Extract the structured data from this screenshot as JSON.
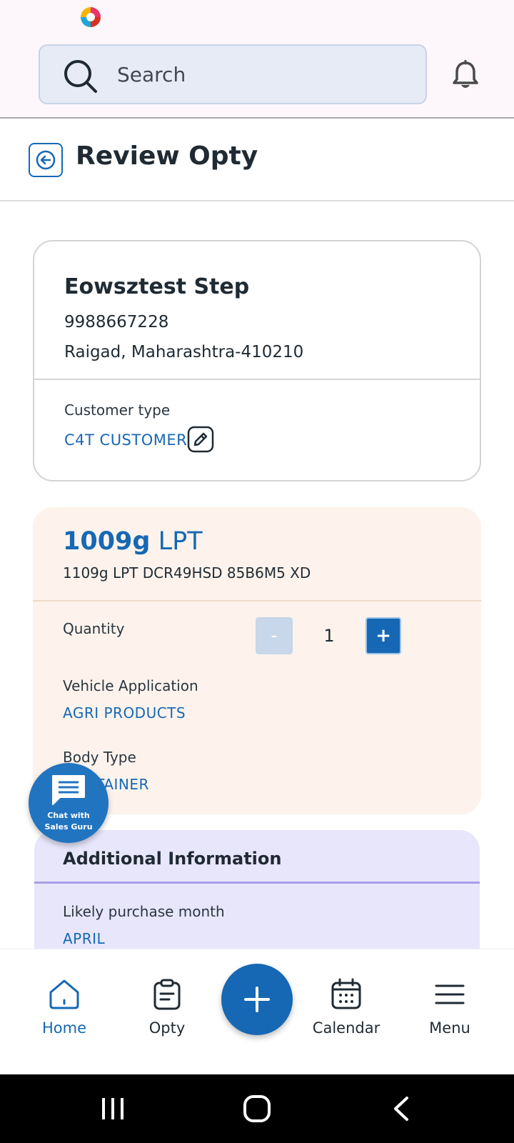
{
  "search": {
    "placeholder": "Search"
  },
  "header": {
    "title": "Review Opty"
  },
  "customer": {
    "name": "Eowsztest Step",
    "phone": "9988667228",
    "address": "Raigad, Maharashtra-410210",
    "type_label": "Customer type",
    "type_value": "C4T CUSTOMER"
  },
  "vehicle": {
    "title_bold": "1009g",
    "title_rest": "LPT",
    "subtitle": "1109g LPT DCR49HSD 85B6M5 XD",
    "quantity_label": "Quantity",
    "quantity_minus": "-",
    "quantity_value": "1",
    "quantity_plus": "+",
    "application_label": "Vehicle Application",
    "application_value": "AGRI PRODUCTS",
    "body_label": "Body Type",
    "body_value": "CONTAINER"
  },
  "chat": {
    "line1": "Chat with",
    "line2": "Sales Guru"
  },
  "additional": {
    "title": "Additional Information",
    "month_label": "Likely purchase month",
    "month_value": "APRIL"
  },
  "nav": {
    "home": "Home",
    "opty": "Opty",
    "calendar": "Calendar",
    "menu": "Menu"
  },
  "colors": {
    "accent": "#1668b4",
    "vehicle_bg": "#fdf3ec",
    "additional_bg": "#e8e6fb"
  }
}
